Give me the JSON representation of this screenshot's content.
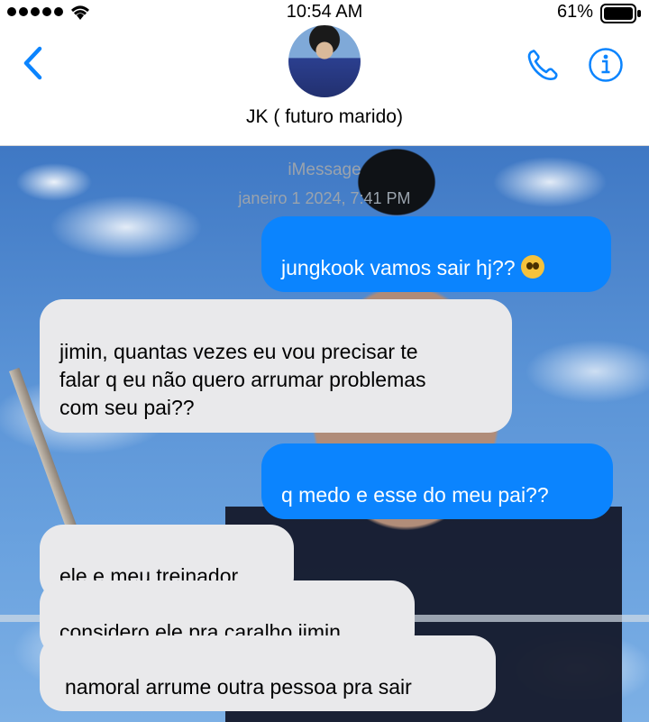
{
  "status_bar": {
    "time": "10:54 AM",
    "battery": "61%"
  },
  "header": {
    "contact_name": "JK ( futuro marido)"
  },
  "chat": {
    "service": "iMessage",
    "timestamp": "janeiro 1 2024, 7:41 PM",
    "messages": [
      {
        "direction": "sent",
        "text": "jungkook vamos sair hj??",
        "emoji": "pleading-face"
      },
      {
        "direction": "received",
        "text": "jimin, quantas vezes eu vou precisar te\nfalar q eu não quero arrumar problemas\ncom seu pai??"
      },
      {
        "direction": "sent",
        "text": "q medo e esse do meu pai??"
      },
      {
        "direction": "received",
        "text": "ele e meu treinador"
      },
      {
        "direction": "received",
        "text": "considero ele pra caralho jimin"
      },
      {
        "direction": "received",
        "text": "namoral arrume outra pessoa pra sair"
      }
    ]
  },
  "colors": {
    "accent": "#0b84fe",
    "received_bubble": "#e9e9eb",
    "meta_text": "#9aa3ad"
  }
}
